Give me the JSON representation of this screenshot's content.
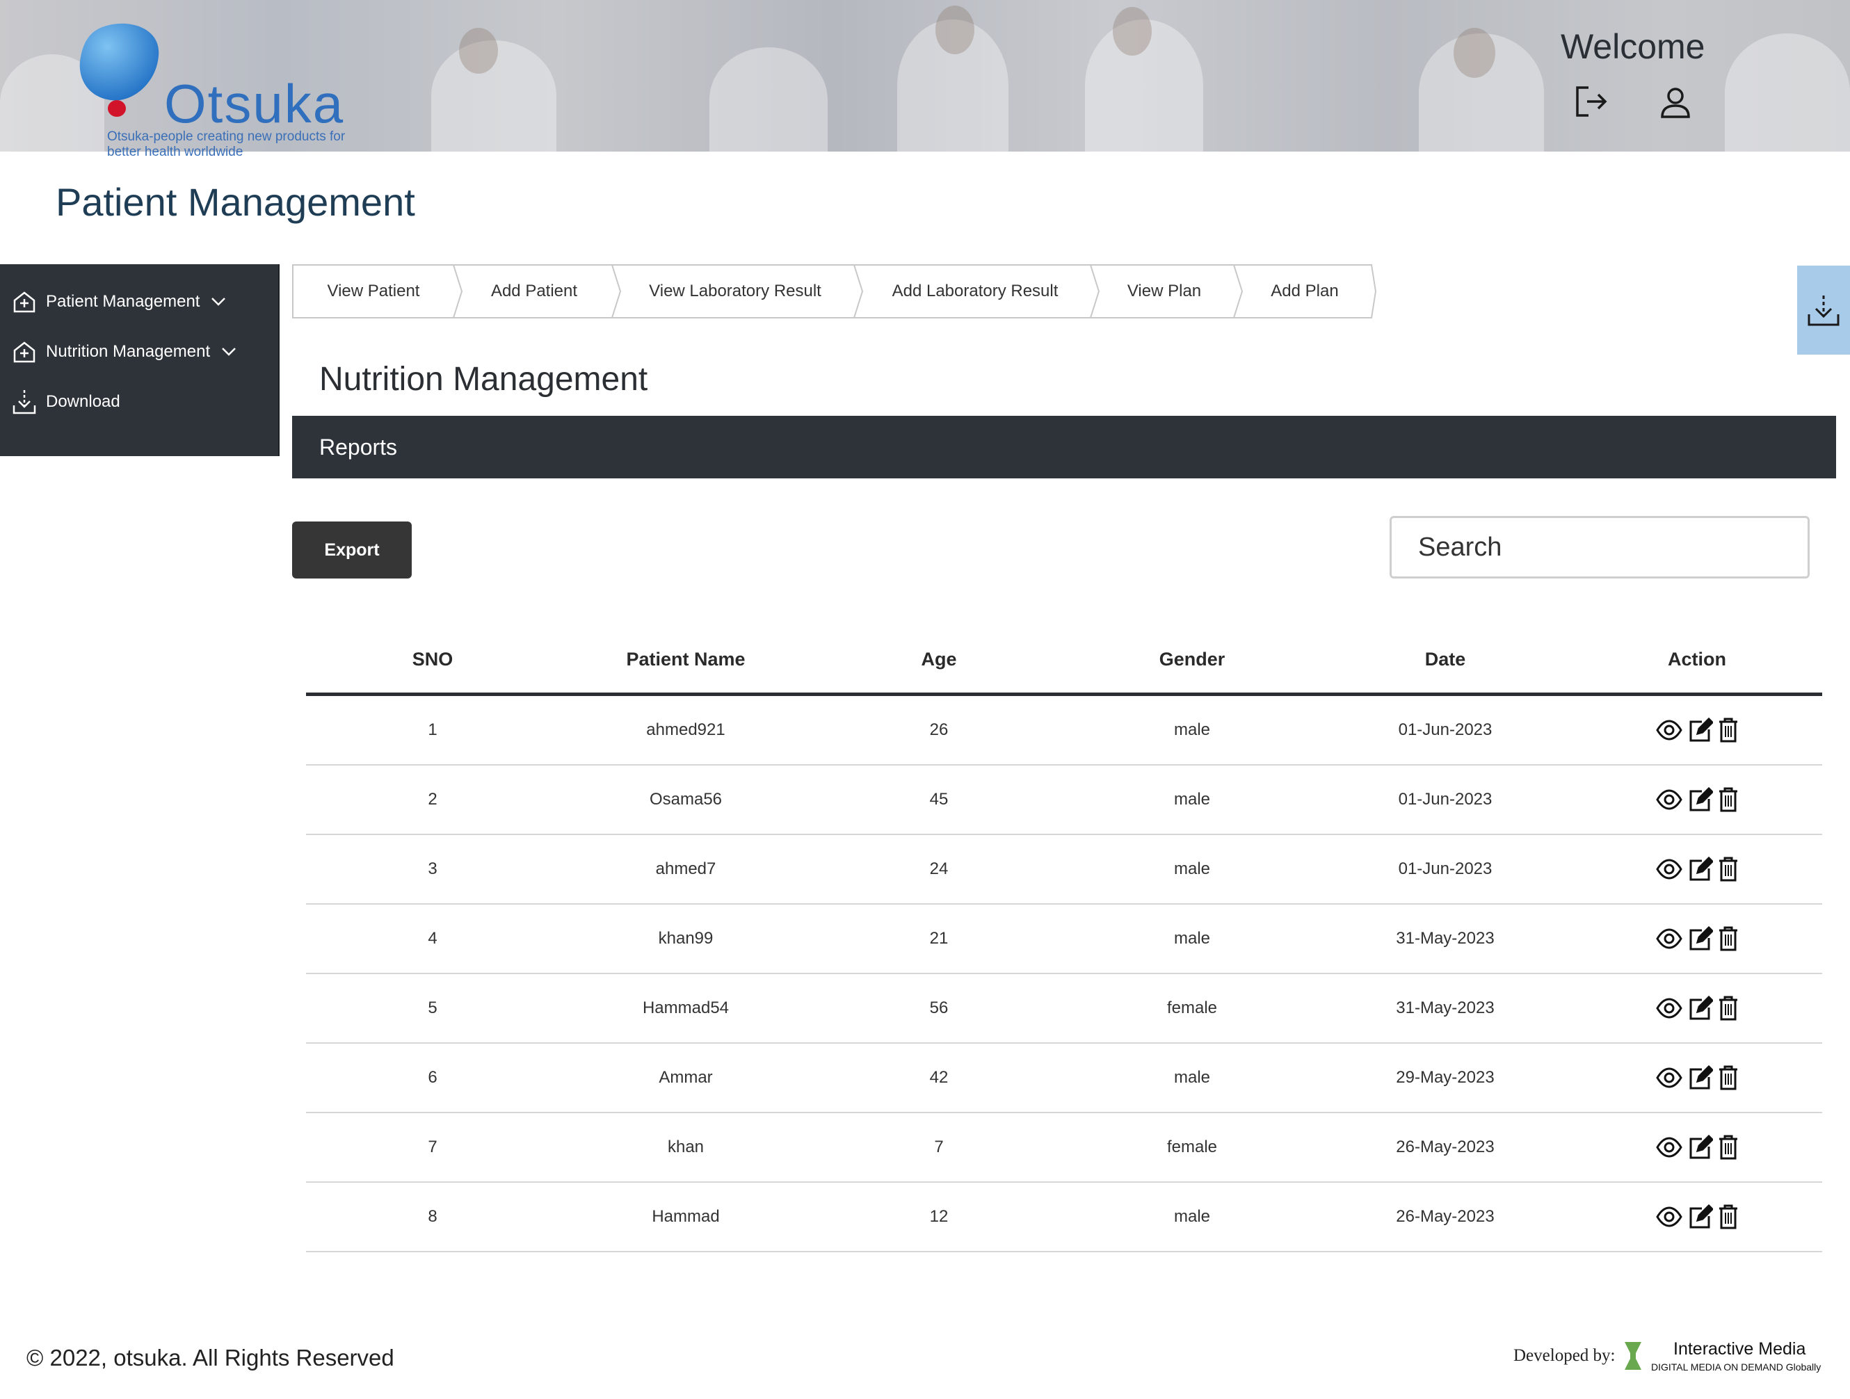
{
  "header": {
    "logo_text": "Otsuka",
    "logo_tagline": "Otsuka-people creating new products for better health worldwide",
    "welcome": "Welcome"
  },
  "page_title": "Patient Management",
  "sidebar": {
    "items": [
      {
        "label": "Patient Management",
        "icon": "hospital-icon",
        "expandable": true
      },
      {
        "label": "Nutrition Management",
        "icon": "hospital-icon",
        "expandable": true
      },
      {
        "label": "Download",
        "icon": "download-icon",
        "expandable": false
      }
    ]
  },
  "steps": [
    "View Patient",
    "Add Patient",
    "View Laboratory Result",
    "Add Laboratory Result",
    "View Plan",
    "Add Plan"
  ],
  "section_title": "Nutrition Management",
  "reports_label": "Reports",
  "export_label": "Export",
  "search": {
    "placeholder": "Search",
    "value": ""
  },
  "table": {
    "columns": [
      "SNO",
      "Patient Name",
      "Age",
      "Gender",
      "Date",
      "Action"
    ],
    "rows": [
      {
        "sno": "1",
        "name": "ahmed921",
        "age": "26",
        "gender": "male",
        "date": "01-Jun-2023"
      },
      {
        "sno": "2",
        "name": "Osama56",
        "age": "45",
        "gender": "male",
        "date": "01-Jun-2023"
      },
      {
        "sno": "3",
        "name": "ahmed7",
        "age": "24",
        "gender": "male",
        "date": "01-Jun-2023"
      },
      {
        "sno": "4",
        "name": "khan99",
        "age": "21",
        "gender": "male",
        "date": "31-May-2023"
      },
      {
        "sno": "5",
        "name": "Hammad54",
        "age": "56",
        "gender": "female",
        "date": "31-May-2023"
      },
      {
        "sno": "6",
        "name": "Ammar",
        "age": "42",
        "gender": "male",
        "date": "29-May-2023"
      },
      {
        "sno": "7",
        "name": "khan",
        "age": "7",
        "gender": "female",
        "date": "26-May-2023"
      },
      {
        "sno": "8",
        "name": "Hammad",
        "age": "12",
        "gender": "male",
        "date": "26-May-2023"
      }
    ]
  },
  "footer": {
    "copyright": "© 2022, otsuka. All Rights Reserved",
    "developed_by": "Developed by:",
    "developer_name": "Interactive Media",
    "developer_tagline": "DIGITAL MEDIA ON DEMAND Globally"
  },
  "colors": {
    "dark_panel": "#2d3339",
    "export_button": "#363636",
    "side_download_tab": "#a9cbea",
    "title_blue": "#1f3e56",
    "logo_blue": "#2f6fbd",
    "logo_red": "#d2142a"
  }
}
